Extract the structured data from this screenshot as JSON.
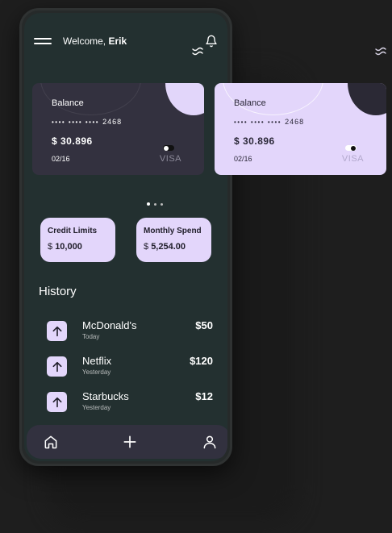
{
  "header": {
    "welcome_prefix": "Welcome,",
    "user_name": "Erik"
  },
  "cards": [
    {
      "title": "Balance",
      "masked": "•••• •••• ••••",
      "last4": "2468",
      "amount": "$ 30.896",
      "expiry": "02/16",
      "brand": "VISA",
      "theme": "dark",
      "background": "#33313f"
    },
    {
      "title": "Balance",
      "masked": "•••• •••• ••••",
      "last4": "2468",
      "amount": "$ 30.896",
      "expiry": "02/16",
      "brand": "VISA",
      "theme": "light",
      "background": "#e3d6fb"
    }
  ],
  "pager": {
    "count": 3,
    "active": 0
  },
  "stats": {
    "credit": {
      "label": "Credit Limits",
      "currency": "$",
      "value": "10,000"
    },
    "spend": {
      "label": "Monthly Spend",
      "currency": "$",
      "value": "5,254.00"
    }
  },
  "history": {
    "title": "History",
    "items": [
      {
        "name": "McDonald's",
        "date": "Today",
        "amount": "$50",
        "icon": "arrow-up-icon"
      },
      {
        "name": "Netflix",
        "date": "Yesterday",
        "amount": "$120",
        "icon": "arrow-up-icon"
      },
      {
        "name": "Starbucks",
        "date": "Yesterday",
        "amount": "$12",
        "icon": "arrow-up-icon"
      }
    ]
  },
  "nav": {
    "items": [
      {
        "icon": "home-icon"
      },
      {
        "icon": "plus-icon"
      },
      {
        "icon": "user-icon"
      }
    ]
  },
  "colors": {
    "background": "#1e1e1e",
    "screen": "#233030",
    "accent": "#e3d6fb",
    "card_dark": "#33313f",
    "navbar": "#32313f"
  }
}
